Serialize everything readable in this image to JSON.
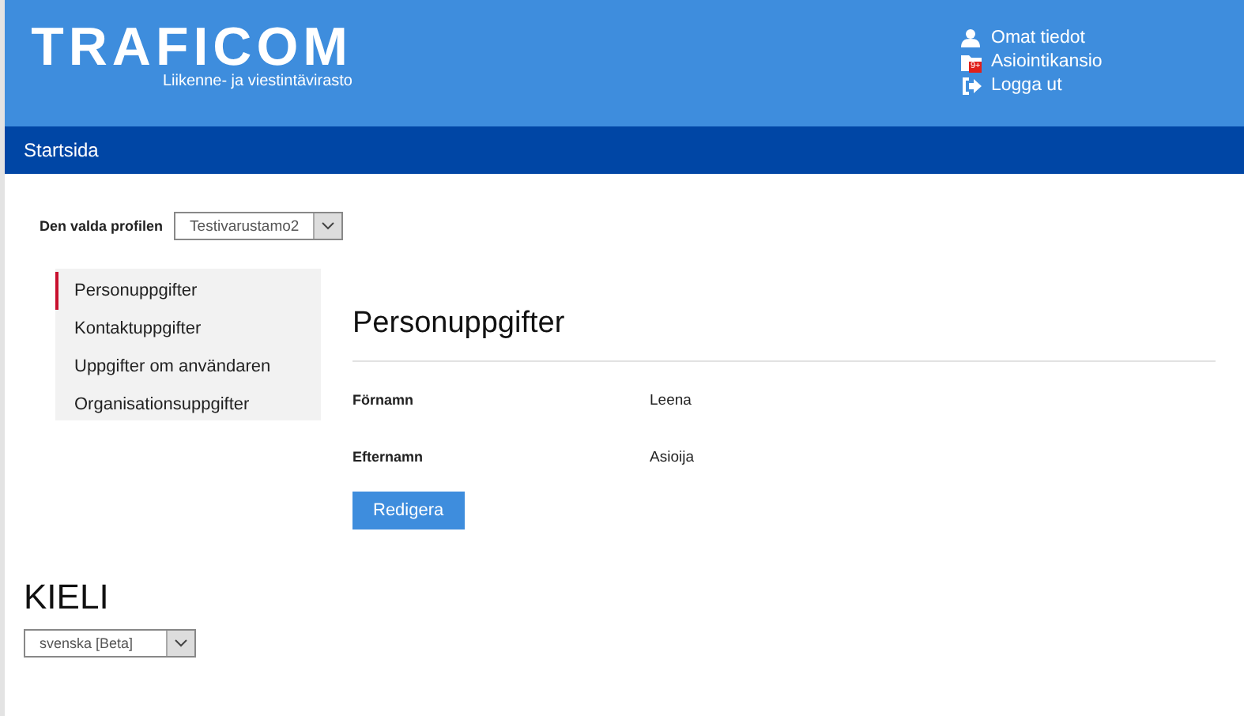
{
  "header": {
    "logo": "TRAFICOM",
    "tagline": "Liikenne- ja viestintävirasto",
    "links": [
      {
        "kind": "user",
        "label": "Omat tiedot"
      },
      {
        "kind": "folder",
        "label": "Asiointikansio",
        "badge": "9+"
      },
      {
        "kind": "logout",
        "label": "Logga ut"
      }
    ]
  },
  "nav": {
    "label": "Startsida"
  },
  "profile": {
    "label": "Den valda profilen",
    "value": "Testivarustamo2"
  },
  "sidebar": {
    "items": [
      {
        "label": "Personuppgifter",
        "selected": true
      },
      {
        "label": "Kontaktuppgifter",
        "selected": false
      },
      {
        "label": "Uppgifter om användaren",
        "selected": false
      },
      {
        "label": "Organisationsuppgifter",
        "selected": false
      }
    ]
  },
  "content": {
    "title": "Personuppgifter",
    "fields": [
      {
        "label": "Förnamn",
        "value": "Leena"
      },
      {
        "label": "Efternamn",
        "value": "Asioija"
      }
    ],
    "button": "Redigera"
  },
  "language": {
    "title": "KIELI",
    "value": "svenska [Beta]"
  }
}
